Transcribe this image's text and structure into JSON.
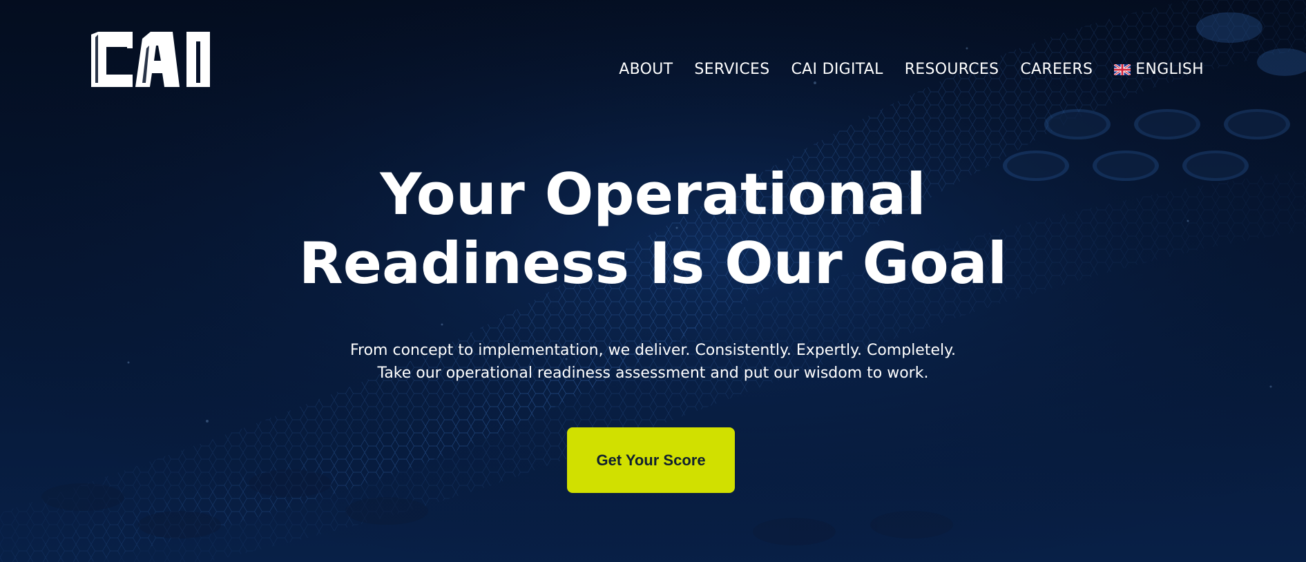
{
  "logo": {
    "text": "CAI"
  },
  "nav": {
    "items": [
      {
        "label": "ABOUT"
      },
      {
        "label": "SERVICES"
      },
      {
        "label": "CAI DIGITAL"
      },
      {
        "label": "RESOURCES"
      },
      {
        "label": "CAREERS"
      }
    ],
    "language": {
      "label": "ENGLISH",
      "icon": "uk-flag-icon"
    }
  },
  "hero": {
    "headline_line1": "Your Operational",
    "headline_line2": "Readiness Is Our Goal",
    "subtext_line1": "From concept to implementation, we deliver. Consistently. Expertly. Completely.",
    "subtext_line2": "Take our operational readiness assessment and put our wisdom to work.",
    "cta_label": "Get Your Score"
  },
  "colors": {
    "background": "#041028",
    "accent": "#d1e000",
    "text": "#ffffff",
    "cta_text": "#10202e"
  }
}
